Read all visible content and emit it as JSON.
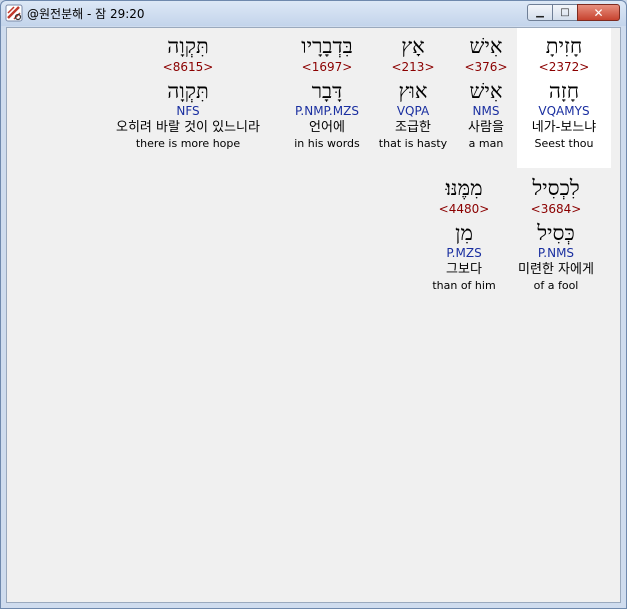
{
  "window": {
    "title": "@원전분해 - 잠 29:20",
    "icon": "app-logo-icon",
    "buttons": {
      "minimize": "▁",
      "maximize": "□",
      "close": "✕"
    }
  },
  "words": [
    {
      "hebrew": "חָזִיתָ",
      "strong": "<2372>",
      "lemma": "חָזָה",
      "parse": "VQAMYS",
      "korean": "네가-보느냐",
      "english": "Seest thou",
      "selected": true
    },
    {
      "hebrew": "אִישׁ",
      "strong": "<376>",
      "lemma": "אִישׁ",
      "parse": "NMS",
      "korean": "사람을",
      "english": "a man",
      "selected": false
    },
    {
      "hebrew": "אָץ",
      "strong": "<213>",
      "lemma": "אוּץ",
      "parse": "VQPA",
      "korean": "조급한",
      "english": "that is hasty",
      "selected": false
    },
    {
      "hebrew": "בִּדְבָרָיו",
      "strong": "<1697>",
      "lemma": "דָּבָר",
      "parse": "P.NMP.MZS",
      "korean": "언어에",
      "english": "in his words",
      "selected": false
    },
    {
      "hebrew": "תִּקְוָה",
      "strong": "<8615>",
      "lemma": "תִּקְוָה",
      "parse": "NFS",
      "korean": "오히려 바랄 것이 있느니라",
      "english": "there is more hope",
      "selected": false
    },
    {
      "hebrew": "לִכְסִיל",
      "strong": "<3684>",
      "lemma": "כְּסִיל",
      "parse": "P.NMS",
      "korean": "미련한 자에게",
      "english": "of a fool",
      "selected": false
    },
    {
      "hebrew": "מִמֶּנּוּ׃",
      "strong": "<4480>",
      "lemma": "מִן",
      "parse": "P.MZS",
      "korean": "그보다",
      "english": "than of him",
      "selected": false
    }
  ],
  "colors": {
    "strong": "#8b0000",
    "parse": "#1a2fa0",
    "selection": "#ffffff",
    "background": "#f0f0f0"
  }
}
